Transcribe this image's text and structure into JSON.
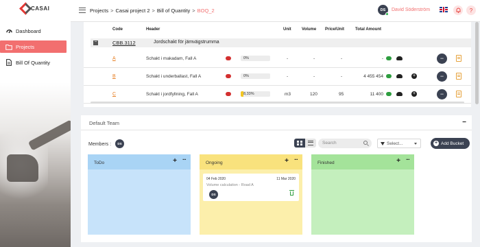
{
  "app": {
    "logo_text": "CASAI"
  },
  "sidebar": {
    "items": [
      {
        "label": "Dashboard",
        "icon": "dashboard-icon",
        "active": false
      },
      {
        "label": "Projects",
        "icon": "folder-icon",
        "active": true
      },
      {
        "label": "Bill Of Quantity",
        "icon": "document-icon",
        "active": false
      }
    ]
  },
  "header": {
    "breadcrumb": [
      "Projects",
      "Casai project 2",
      "Bill of Quantity",
      "BOQ_2"
    ],
    "user_initials": "DS",
    "user_name": "David Söderström",
    "language_flag": "uk-flag-icon",
    "bell_icon": "bell-icon",
    "help_label": "?"
  },
  "boq": {
    "columns": [
      "Code",
      "Header",
      "Unit",
      "Volume",
      "Price/Unit",
      "Total Amount"
    ],
    "group": {
      "code": "CBB.3112",
      "header": "Jordschakt för jämvägstrumma"
    },
    "rows": [
      {
        "code": "A",
        "header": "Schakt i makadam, Fall A",
        "progress_label": "0%",
        "progress": 0,
        "unit": "-",
        "volume": "-",
        "price": "-",
        "total": "-",
        "add_button": false
      },
      {
        "code": "B",
        "header": "Schakt i underballast, Fall A",
        "progress_label": "0%",
        "progress": 0,
        "unit": "-",
        "volume": "-",
        "price": "-",
        "total": "4 455 454",
        "add_button": true
      },
      {
        "code": "C",
        "header": "Schakt i jordfyllning, Fall A",
        "progress_label": "8,33%",
        "progress": 8.33,
        "unit": "m3",
        "volume": "120",
        "price": "95",
        "total": "11 400",
        "add_button": true
      }
    ]
  },
  "team": {
    "title": "Default Team",
    "collapse_label": "−",
    "members_label": "Members :",
    "members": [
      "DS"
    ],
    "search_placeholder": "Search",
    "select_label": "Select...",
    "add_bucket_label": "Add Bucket",
    "buckets": [
      {
        "name": "ToDo",
        "header_color": "#a9d4f5",
        "body_color": "#c7e3fa",
        "tasks": []
      },
      {
        "name": "Ongoing",
        "header_color": "#f9e27d",
        "body_color": "#fcefab",
        "tasks": [
          {
            "start": "04 Feb 2020",
            "end": "11 Mar 2020",
            "title": "Volume calculation - Road A",
            "assignee": "DS"
          }
        ]
      },
      {
        "name": "Finished",
        "header_color": "#a4e39a",
        "body_color": "#c4efbd",
        "tasks": []
      }
    ]
  },
  "colors": {
    "accent": "#f26f6f",
    "dark": "#3b4252",
    "comment_red": "#d32f2f",
    "comment_green": "#2e9d3f",
    "progress": "#f3c623"
  }
}
